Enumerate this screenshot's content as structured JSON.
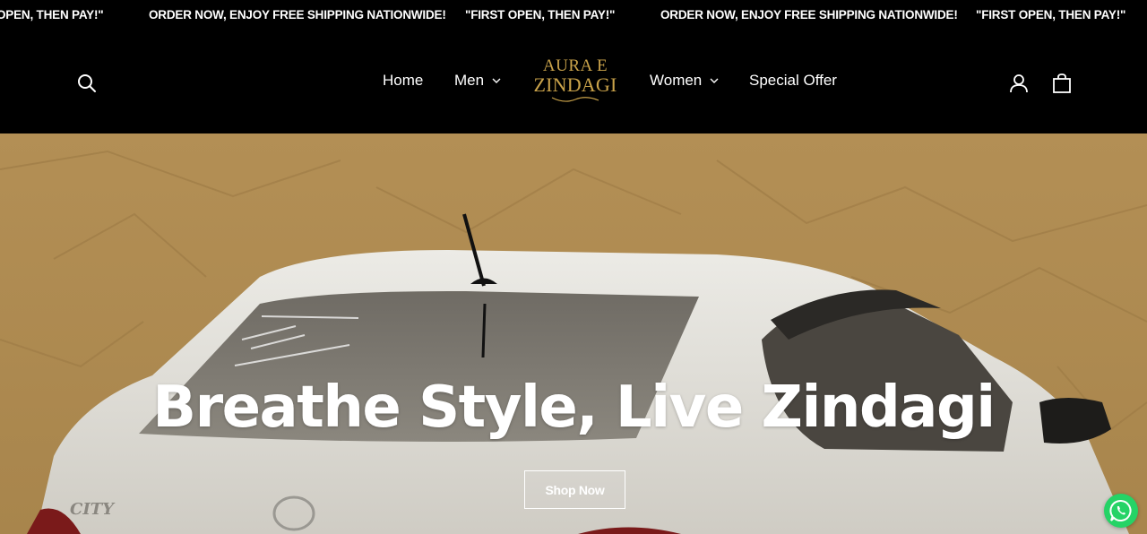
{
  "announcement": {
    "messages": [
      "OPEN, THEN PAY!\"",
      "ORDER NOW, ENJOY FREE SHIPPING NATIONWIDE!",
      "\"FIRST OPEN, THEN PAY!\"",
      "ORDER NOW, ENJOY FREE SHIPPING NATIONWIDE!",
      "\"FIRST OPEN, THEN PAY!\""
    ]
  },
  "header": {
    "logo_line1": "AURA E",
    "logo_line2": "ZINDAGI",
    "logo_color": "#c9a24a",
    "nav": {
      "home": "Home",
      "men": "Men",
      "women": "Women",
      "special_offer": "Special Offer"
    },
    "icons": {
      "search": "search-icon",
      "account": "account-icon",
      "cart": "cart-icon"
    }
  },
  "hero": {
    "title": "Breathe Style, Live Zindagi",
    "cta": "Shop Now"
  },
  "floating": {
    "whatsapp_icon": "whatsapp-icon",
    "whatsapp_color": "#25d366"
  }
}
